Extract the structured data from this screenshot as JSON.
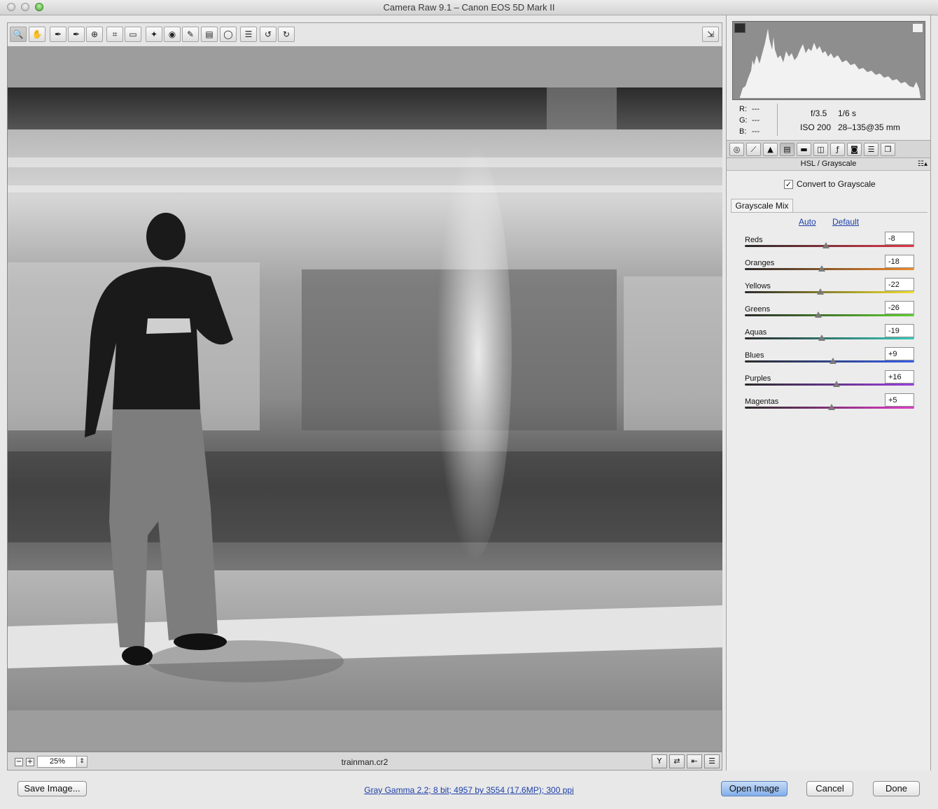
{
  "window": {
    "title": "Camera Raw 9.1  –  Canon EOS 5D Mark II"
  },
  "toolbar": {
    "tools": [
      {
        "name": "zoom-tool",
        "glyph": "🔍"
      },
      {
        "name": "hand-tool",
        "glyph": "✋"
      },
      {
        "name": "white-balance-tool",
        "glyph": "✒"
      },
      {
        "name": "color-sampler-tool",
        "glyph": "✒"
      },
      {
        "name": "targeted-adjustment-tool",
        "glyph": "⊕"
      },
      {
        "name": "crop-tool",
        "glyph": "⌗"
      },
      {
        "name": "straighten-tool",
        "glyph": "▭"
      },
      {
        "name": "spot-removal-tool",
        "glyph": "✦"
      },
      {
        "name": "red-eye-removal-tool",
        "glyph": "◉"
      },
      {
        "name": "adjustment-brush-tool",
        "glyph": "✎"
      },
      {
        "name": "graduated-filter-tool",
        "glyph": "▤"
      },
      {
        "name": "radial-filter-tool",
        "glyph": "◯"
      },
      {
        "name": "preferences-tool",
        "glyph": "☰"
      },
      {
        "name": "rotate-ccw-tool",
        "glyph": "↺"
      },
      {
        "name": "rotate-cw-tool",
        "glyph": "↻"
      }
    ],
    "fullscreen_glyph": "⇲"
  },
  "status": {
    "zoom": "25%",
    "filename": "trainman.cr2"
  },
  "histogram": {
    "rgb": [
      {
        "label": "R:",
        "value": "---"
      },
      {
        "label": "G:",
        "value": "---"
      },
      {
        "label": "B:",
        "value": "---"
      }
    ],
    "aperture": "f/3.5",
    "shutter": "1/6 s",
    "iso": "ISO 200",
    "lens": "28–135@35 mm"
  },
  "panel": {
    "title": "HSL / Grayscale",
    "convert_label": "Convert to Grayscale",
    "convert_checked": "✓",
    "subtab": "Grayscale Mix",
    "auto_label": "Auto",
    "default_label": "Default",
    "sliders": [
      {
        "label": "Reds",
        "value": "-8",
        "num": -8,
        "from": "#2a2a2a",
        "to": "#e0394a"
      },
      {
        "label": "Oranges",
        "value": "-18",
        "num": -18,
        "from": "#2a2a2a",
        "to": "#f08a2a"
      },
      {
        "label": "Yellows",
        "value": "-22",
        "num": -22,
        "from": "#2a2a2a",
        "to": "#f2e030"
      },
      {
        "label": "Greens",
        "value": "-26",
        "num": -26,
        "from": "#2a2a2a",
        "to": "#5fd02e"
      },
      {
        "label": "Aquas",
        "value": "-19",
        "num": -19,
        "from": "#2a2a2a",
        "to": "#38c9b8"
      },
      {
        "label": "Blues",
        "value": "+9",
        "num": 9,
        "from": "#2a2a2a",
        "to": "#3a5ee8"
      },
      {
        "label": "Purples",
        "value": "+16",
        "num": 16,
        "from": "#2a2a2a",
        "to": "#9a3ee0"
      },
      {
        "label": "Magentas",
        "value": "+5",
        "num": 5,
        "from": "#2a2a2a",
        "to": "#e03ac8"
      }
    ]
  },
  "footer": {
    "save_label": "Save Image...",
    "workflow_info": "Gray Gamma 2.2; 8 bit; 4957 by 3554 (17.6MP); 300 ppi",
    "open_label": "Open Image",
    "cancel_label": "Cancel",
    "done_label": "Done"
  },
  "colors": {
    "primary_button": "#82aeea",
    "link": "#1b3fa8"
  }
}
